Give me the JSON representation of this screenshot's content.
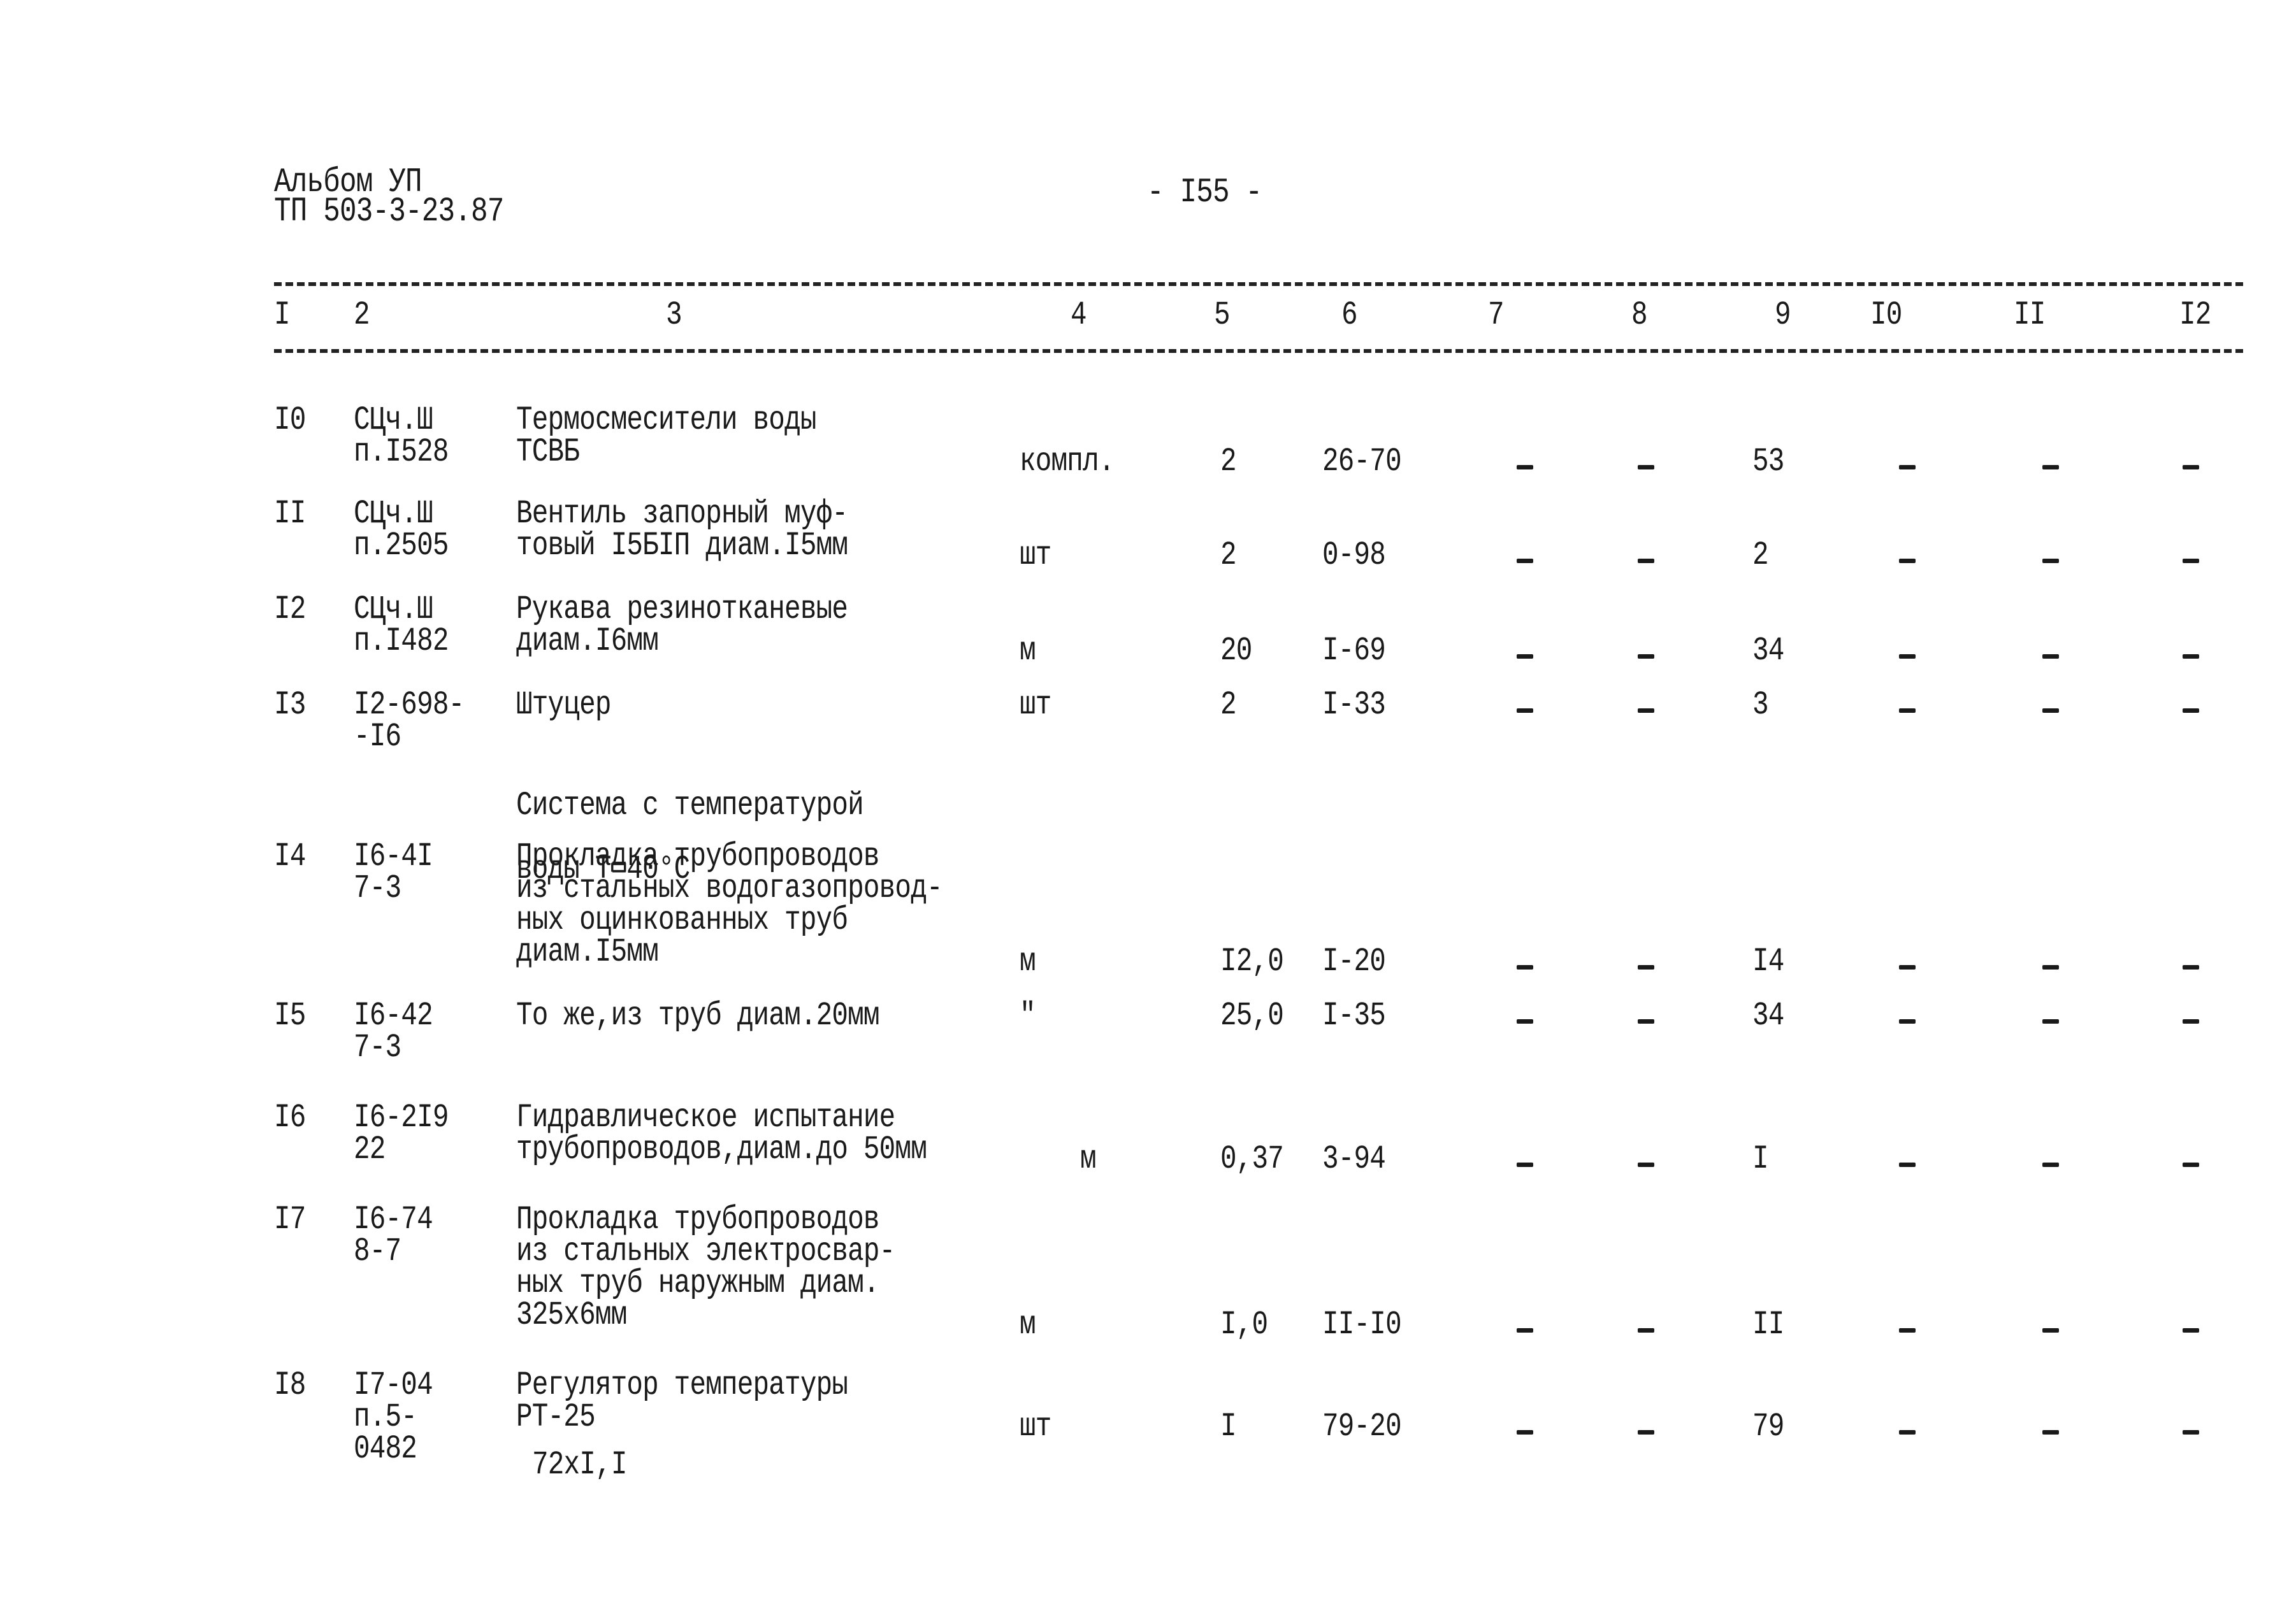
{
  "header": {
    "album": "Альбом УП",
    "doc_code": "ТП 503-3-23.87",
    "page_number": "- I55 -"
  },
  "columns": [
    "I",
    "2",
    "3",
    "4",
    "5",
    "6",
    "7",
    "8",
    "9",
    "I0",
    "II",
    "I2"
  ],
  "rows": [
    {
      "n": "I0",
      "code": [
        "СЦч.Ш",
        "п.I528"
      ],
      "name": [
        "Термосмесители воды",
        "ТСВБ"
      ],
      "unit": "компл.",
      "qty": "2",
      "price": "26-70",
      "c7": "-",
      "c8": "-",
      "c9": "53",
      "c10": "-",
      "c11": "-",
      "c12": "-"
    },
    {
      "n": "II",
      "code": [
        "СЦч.Ш",
        "п.2505"
      ],
      "name": [
        "Вентиль запорный муф-",
        "товый I5БIП диам.I5мм"
      ],
      "unit": "шт",
      "qty": "2",
      "price": "0-98",
      "c7": "-",
      "c8": "-",
      "c9": "2",
      "c10": "-",
      "c11": "-",
      "c12": "-"
    },
    {
      "n": "I2",
      "code": [
        "СЦч.Ш",
        "п.I482"
      ],
      "name": [
        "Рукава резинотканевые",
        "диам.I6мм"
      ],
      "unit": "м",
      "qty": "20",
      "price": "I-69",
      "c7": "-",
      "c8": "-",
      "c9": "34",
      "c10": "-",
      "c11": "-",
      "c12": "-"
    },
    {
      "n": "I3",
      "code": [
        "I2-698-",
        "-I6"
      ],
      "name": [
        "Штуцер"
      ],
      "unit": "шт",
      "qty": "2",
      "price": "I-33",
      "c7": "-",
      "c8": "-",
      "c9": "3",
      "c10": "-",
      "c11": "-",
      "c12": "-"
    },
    {
      "n": "I4",
      "code": [
        "I6-4I",
        "7-3"
      ],
      "name": [
        "Прокладка трубопроводов",
        "из стальных водогазопровод-",
        "ных оцинкованных труб",
        "диам.I5мм"
      ],
      "unit": "м",
      "qty": "I2,0",
      "price": "I-20",
      "c7": "-",
      "c8": "-",
      "c9": "I4",
      "c10": "-",
      "c11": "-",
      "c12": "-"
    },
    {
      "n": "I5",
      "code": [
        "I6-42",
        "7-3"
      ],
      "name": [
        "То же,из труб диам.20мм"
      ],
      "unit": "\"",
      "qty": "25,0",
      "price": "I-35",
      "c7": "-",
      "c8": "-",
      "c9": "34",
      "c10": "-",
      "c11": "-",
      "c12": "-"
    },
    {
      "n": "I6",
      "code": [
        "I6-2I9",
        "22"
      ],
      "name": [
        "Гидравлическое испытание",
        "трубопроводов,диам.до 50мм"
      ],
      "unit": "м",
      "qty": "0,37",
      "price": "3-94",
      "c7": "-",
      "c8": "-",
      "c9": "I",
      "c10": "-",
      "c11": "-",
      "c12": "-"
    },
    {
      "n": "I7",
      "code": [
        "I6-74",
        "8-7"
      ],
      "name": [
        "Прокладка трубопроводов",
        "из стальных электросвар-",
        "ных труб наружным диам.",
        "325х6мм"
      ],
      "unit": "м",
      "qty": "I,0",
      "price": "II-I0",
      "c7": "-",
      "c8": "-",
      "c9": "II",
      "c10": "-",
      "c11": "-",
      "c12": "-"
    },
    {
      "n": "I8",
      "code": [
        "I7-04",
        "п.5-",
        "0482"
      ],
      "name": [
        "Регулятор температуры",
        "РТ-25"
      ],
      "unit": "шт",
      "qty": "I",
      "price": "79-20",
      "c7": "-",
      "c8": "-",
      "c9": "79",
      "c10": "-",
      "c11": "-",
      "c12": "-"
    }
  ],
  "section_heading": [
    "Система с температурой",
    "воды Т=40°С"
  ],
  "note_row18": "72хI,I"
}
